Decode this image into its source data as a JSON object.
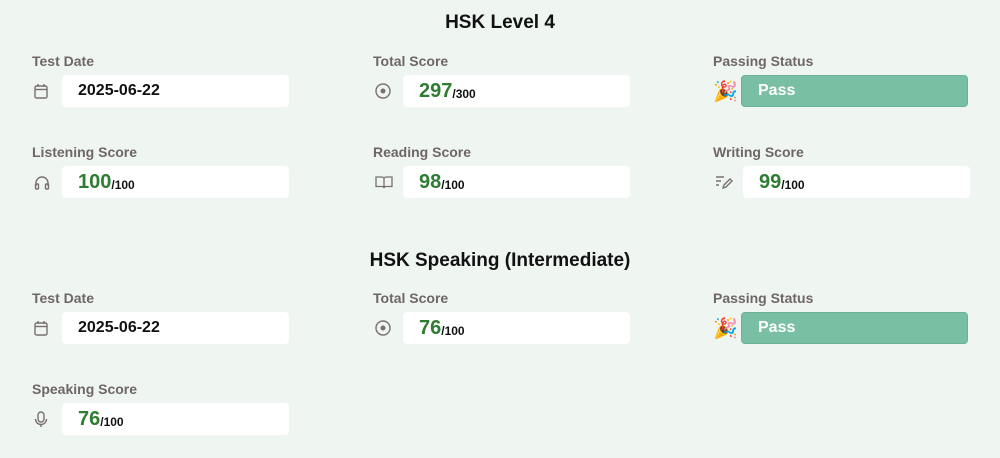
{
  "sections": [
    {
      "title": "HSK Level 4",
      "test_date": {
        "label": "Test Date",
        "value": "2025-06-22"
      },
      "total": {
        "label": "Total Score",
        "value": "297",
        "max": "/300"
      },
      "status": {
        "label": "Passing Status",
        "value": "Pass",
        "icon": "🎉"
      },
      "listening": {
        "label": "Listening Score",
        "value": "100",
        "max": "/100"
      },
      "reading": {
        "label": "Reading Score",
        "value": "98",
        "max": "/100"
      },
      "writing": {
        "label": "Writing Score",
        "value": "99",
        "max": "/100"
      }
    },
    {
      "title": "HSK Speaking (Intermediate)",
      "test_date": {
        "label": "Test Date",
        "value": "2025-06-22"
      },
      "total": {
        "label": "Total Score",
        "value": "76",
        "max": "/100"
      },
      "status": {
        "label": "Passing Status",
        "value": "Pass",
        "icon": "🎉"
      },
      "speaking": {
        "label": "Speaking Score",
        "value": "76",
        "max": "/100"
      }
    }
  ],
  "colors": {
    "score": "#2e7d32",
    "pass": "#79bfa3",
    "background": "#eff5f1"
  }
}
